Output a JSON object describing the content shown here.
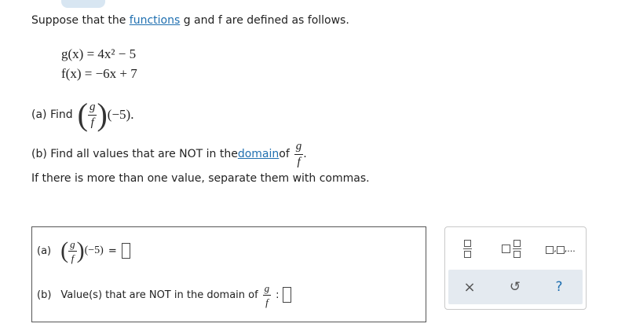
{
  "question": {
    "intro_before_link": "Suppose that the ",
    "intro_link": "functions",
    "intro_after_link": " g and f are defined as follows.",
    "g_def": "g(x) = 4x² − 5",
    "f_def": "f(x) = −6x + 7",
    "part_a_prefix": "(a) Find",
    "part_a_arg": "(−5).",
    "part_b_prefix": "(b) Find all values that are NOT in the ",
    "part_b_link": "domain",
    "part_b_mid": " of",
    "part_b_instruction": "If there is more than one value, separate them with commas.",
    "frac_num": "g",
    "frac_den": "f"
  },
  "answer": {
    "a_label": "(a)",
    "a_arg": "(−5)",
    "a_equals": "=",
    "a_value": "",
    "b_label": "(b)",
    "b_text": "Value(s) that are NOT in the domain of",
    "b_colon": ":",
    "b_value": ""
  },
  "toolbar": {
    "fraction_icon": "fraction-icon",
    "mixed_number_icon": "mixed-number-icon",
    "list_icon": "list-icon",
    "list_ellipsis": "...",
    "clear_label": "×",
    "undo_label": "↺",
    "help_label": "?"
  }
}
